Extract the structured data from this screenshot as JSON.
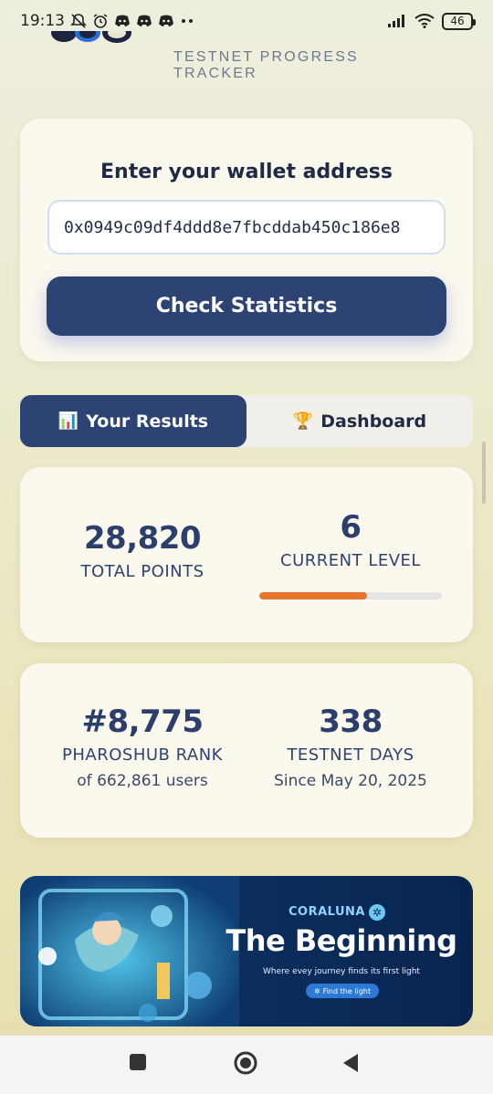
{
  "status_bar": {
    "time": "19:13",
    "battery": "46"
  },
  "header": {
    "subtitle": "TESTNET PROGRESS TRACKER"
  },
  "wallet": {
    "label": "Enter your wallet address",
    "value": "0x0949c09df4ddd8e7fbcddab450c186e8",
    "button_label": "Check Statistics"
  },
  "tabs": [
    {
      "icon": "📊",
      "label": "Your Results",
      "active": true
    },
    {
      "icon": "🏆",
      "label": "Dashboard",
      "active": false
    }
  ],
  "stats": {
    "total_points": {
      "value": "28,820",
      "label": "TOTAL POINTS"
    },
    "current_level": {
      "value": "6",
      "label": "CURRENT LEVEL",
      "progress": 0.59
    },
    "rank": {
      "value": "#8,775",
      "label": "PHAROSHUB RANK",
      "sub": "of 662,861 users"
    },
    "testnet_days": {
      "value": "338",
      "label": "TESTNET DAYS",
      "sub": "Since May 20, 2025"
    }
  },
  "banner": {
    "brand": "CORALUNA",
    "title": "The Beginning",
    "subtitle": "Where evey journey finds its first  light",
    "button_label": "Find the light"
  },
  "colors": {
    "primary": "#2c4374",
    "accent_orange": "#e9742a",
    "card_bg": "#fbf8ee"
  }
}
